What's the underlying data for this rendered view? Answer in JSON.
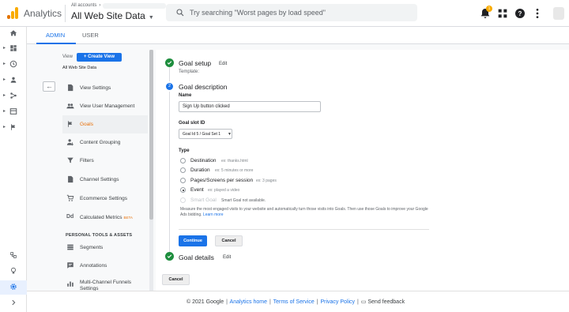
{
  "header": {
    "app_name": "Analytics",
    "accounts_label": "All accounts",
    "property_name": "All Web Site Data",
    "search_placeholder": "Try searching \"Worst pages by load speed\"",
    "notification_count": "1"
  },
  "tabs": [
    {
      "label": "ADMIN",
      "active": true
    },
    {
      "label": "USER",
      "active": false
    }
  ],
  "view_panel": {
    "view_label": "View",
    "create_view_label": "Create View",
    "view_name": "All Web Site Data"
  },
  "menu": {
    "items": [
      {
        "label": "View Settings",
        "icon": "page-icon"
      },
      {
        "label": "View User Management",
        "icon": "people-icon"
      },
      {
        "label": "Goals",
        "icon": "flag-icon",
        "active": true
      },
      {
        "label": "Content Grouping",
        "icon": "person-arrow-icon"
      },
      {
        "label": "Filters",
        "icon": "filter-icon"
      },
      {
        "label": "Channel Settings",
        "icon": "page-icon"
      },
      {
        "label": "Ecommerce Settings",
        "icon": "cart-icon"
      },
      {
        "label": "Calculated Metrics",
        "icon": "dd-icon",
        "badge": "BETA"
      }
    ],
    "section_heading": "PERSONAL TOOLS & ASSETS",
    "personal_items": [
      {
        "label": "Segments",
        "icon": "segments-icon"
      },
      {
        "label": "Annotations",
        "icon": "annotation-icon"
      },
      {
        "label": "Multi-Channel Funnels Settings",
        "icon": "bars-icon"
      }
    ]
  },
  "goal": {
    "setup": {
      "title": "Goal setup",
      "edit": "Edit",
      "template_label": "Template:"
    },
    "description": {
      "step_number": "2",
      "title": "Goal description"
    },
    "name_label": "Name",
    "name_value": "Sign Up button clicked",
    "slot_label": "Goal slot ID",
    "slot_value": "Goal Id 5 / Goal Set 1",
    "type_label": "Type",
    "types": [
      {
        "label": "Destination",
        "hint": "ex: thanks.html",
        "selected": false,
        "disabled": false
      },
      {
        "label": "Duration",
        "hint": "ex: 5 minutes or more",
        "selected": false,
        "disabled": false
      },
      {
        "label": "Pages/Screens per session",
        "hint": "ex: 3 pages",
        "selected": false,
        "disabled": false
      },
      {
        "label": "Event",
        "hint": "ex: played a video",
        "selected": true,
        "disabled": false
      },
      {
        "label": "Smart Goal",
        "hint": "Smart Goal not available.",
        "selected": false,
        "disabled": true
      }
    ],
    "smart_goal_note": "Measure the most engaged visits to your website and automatically turn those visits into Goals. Then use those Goals to improve your Google Ads bidding.",
    "learn_more": "Learn more",
    "continue_label": "Continue",
    "cancel_label": "Cancel",
    "details": {
      "title": "Goal details",
      "edit": "Edit"
    },
    "bottom_cancel_label": "Cancel"
  },
  "footer": {
    "copyright": "© 2021 Google",
    "analytics_home": "Analytics home",
    "terms": "Terms of Service",
    "privacy": "Privacy Policy",
    "feedback": "Send feedback"
  },
  "colors": {
    "accent": "#1a73e8",
    "active_menu": "#e8710a",
    "check_green": "#1e8e3e",
    "logo_orange": "#f9ab00"
  }
}
